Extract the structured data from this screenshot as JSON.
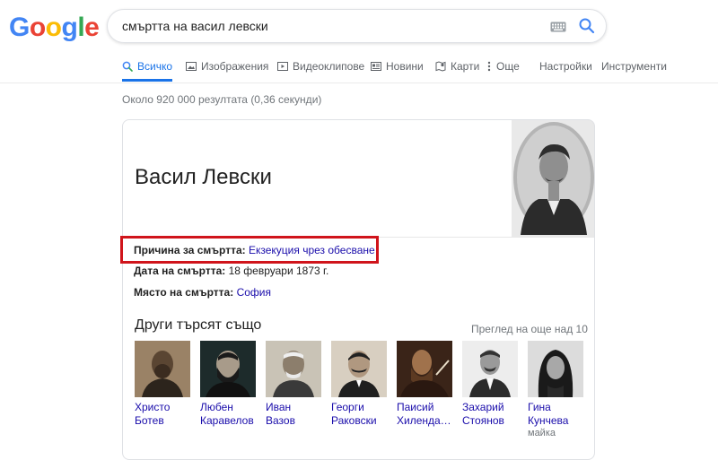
{
  "logo": "Google",
  "search": {
    "query": "смъртта на васил левски"
  },
  "tabs": [
    {
      "label": "Всичко",
      "icon": "search-icon",
      "active": true
    },
    {
      "label": "Изображения",
      "icon": "image-icon"
    },
    {
      "label": "Видеоклипове",
      "icon": "video-icon"
    },
    {
      "label": "Новини",
      "icon": "news-icon"
    },
    {
      "label": "Карти",
      "icon": "map-icon"
    },
    {
      "label": "Още",
      "icon": "more-icon"
    },
    {
      "label": "Настройки"
    },
    {
      "label": "Инструменти"
    }
  ],
  "result_stats": "Около 920 000 резултата (0,36 секунди)",
  "knowledge_panel": {
    "title": "Васил Левски",
    "facts": [
      {
        "label": "Причина за смъртта:",
        "value": "Екзекуция чрез обесване",
        "link": true
      },
      {
        "label": "Дата на смъртта:",
        "value": "18 февруари 1873 г.",
        "link": false
      },
      {
        "label": "Място на смъртта:",
        "value": "София",
        "link": true
      }
    ],
    "also_search_title": "Други търсят също",
    "also_search_more": "Преглед на още над 10",
    "people": [
      {
        "name": "Христо Ботев",
        "sub": ""
      },
      {
        "name": "Любен Каравелов",
        "sub": ""
      },
      {
        "name": "Иван Вазов",
        "sub": ""
      },
      {
        "name": "Георги Раковски",
        "sub": ""
      },
      {
        "name": "Паисий Хилендa…",
        "sub": ""
      },
      {
        "name": "Захарий Стоянов",
        "sub": ""
      },
      {
        "name": "Гина Кунчева",
        "sub": "майка"
      }
    ]
  },
  "colors": {
    "link": "#1a0dab",
    "accent_blue": "#1a73e8",
    "highlight_red": "#d0141b",
    "google_blue": "#4285f4",
    "google_red": "#ea4335",
    "google_yellow": "#fbbc05",
    "google_green": "#34a853"
  }
}
